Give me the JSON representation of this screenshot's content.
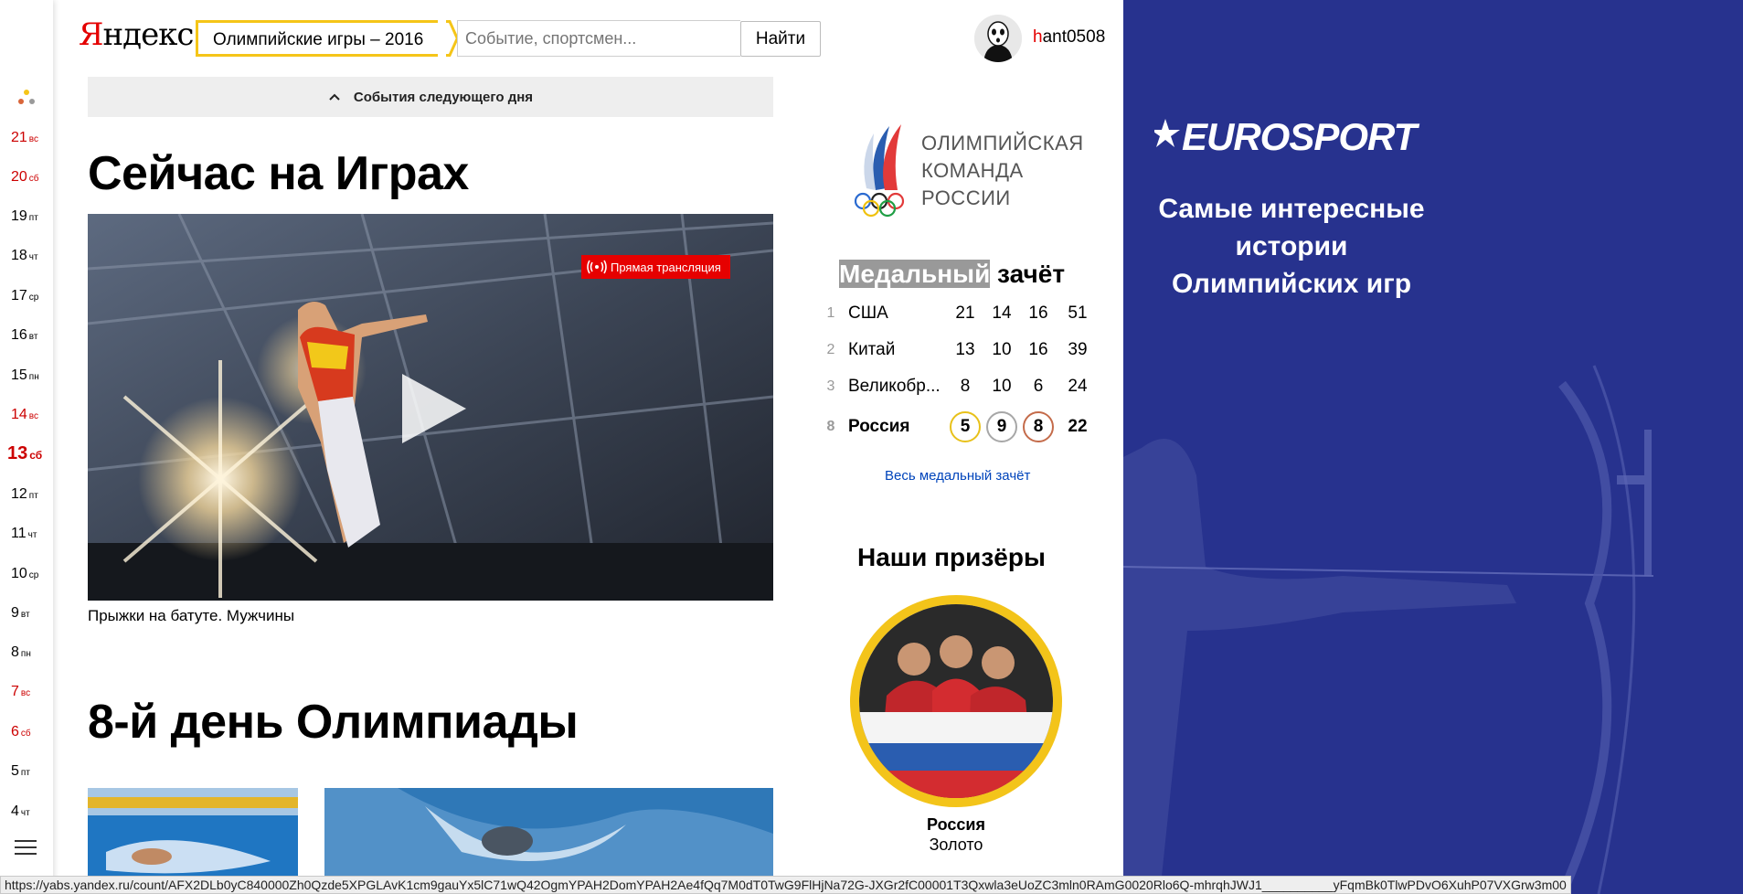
{
  "header": {
    "logo_first": "Я",
    "logo_rest": "ндекс",
    "tag": "Олимпийские игры – 2016",
    "search_placeholder": "Событие, спортсмен...",
    "find_label": "Найти",
    "user_first": "h",
    "user_rest": "ant0508"
  },
  "rail": {
    "days": [
      {
        "n": "21",
        "w": "вс",
        "wknd": true
      },
      {
        "n": "20",
        "w": "сб",
        "wknd": true
      },
      {
        "n": "19",
        "w": "пт",
        "wknd": false
      },
      {
        "n": "18",
        "w": "чт",
        "wknd": false
      },
      {
        "n": "17",
        "w": "ср",
        "wknd": false
      },
      {
        "n": "16",
        "w": "вт",
        "wknd": false
      },
      {
        "n": "15",
        "w": "пн",
        "wknd": false
      },
      {
        "n": "14",
        "w": "вс",
        "wknd": true
      },
      {
        "n": "13",
        "w": "сб",
        "wknd": true
      },
      {
        "n": "12",
        "w": "пт",
        "wknd": false
      },
      {
        "n": "11",
        "w": "чт",
        "wknd": false
      },
      {
        "n": "10",
        "w": "ср",
        "wknd": false
      },
      {
        "n": "9",
        "w": "вт",
        "wknd": false
      },
      {
        "n": "8",
        "w": "пн",
        "wknd": false
      },
      {
        "n": "7",
        "w": "вс",
        "wknd": true
      },
      {
        "n": "6",
        "w": "сб",
        "wknd": true
      },
      {
        "n": "5",
        "w": "пт",
        "wknd": false
      },
      {
        "n": "4",
        "w": "чт",
        "wknd": false
      }
    ]
  },
  "main": {
    "next_day_label": "События следующего дня",
    "now_title": "Сейчас на Играх",
    "live_label": "Прямая трансляция",
    "video_caption": "Прыжки на батуте. Мужчины",
    "day_title": "8-й день Олимпиады"
  },
  "team": {
    "lines": [
      "ОЛИМПИЙСКАЯ",
      "КОМАНДА",
      "РОССИИ"
    ]
  },
  "medals": {
    "title_highlight": "Медальный",
    "title_rest": " зачёт",
    "rows": [
      {
        "rank": "1",
        "country": "США",
        "gold": "21",
        "silver": "14",
        "bronze": "16",
        "total": "51"
      },
      {
        "rank": "2",
        "country": "Китай",
        "gold": "13",
        "silver": "10",
        "bronze": "16",
        "total": "39"
      },
      {
        "rank": "3",
        "country": "Великобр...",
        "gold": "8",
        "silver": "10",
        "bronze": "6",
        "total": "24"
      }
    ],
    "russia": {
      "rank": "8",
      "country": "Россия",
      "gold": "5",
      "silver": "9",
      "bronze": "8",
      "total": "22"
    },
    "all_link": "Весь медальный зачёт"
  },
  "prizes": {
    "title": "Наши призёры",
    "country": "Россия",
    "medal": "Золото"
  },
  "ad": {
    "brand": "EUROSPORT",
    "text": "Самые интересные истории Олимпийских игр",
    "bg_color": "#27328e"
  },
  "status_url": "https://yabs.yandex.ru/count/AFX2DLb0yC840000Zh0Qzde5XPGLAvK1cm9gauYx5lC71wQ42OgmYPAH2DomYPAH2Ae4fQq7M0dT0TwG9FlHjNa72G-JXGr2fC00001T3Qxwla3eUoZC3mln0RAmG0020Rlo6Q-mhrqhJWJ1__________yFqmBk0TlwPDvO6XuhP07VXGrw3m00"
}
